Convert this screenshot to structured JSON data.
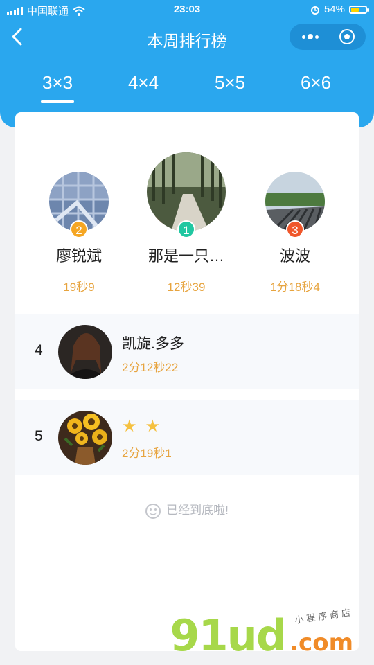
{
  "status_bar": {
    "carrier": "中国联通",
    "time": "23:03",
    "battery_percent": "54%",
    "battery_level": 0.54
  },
  "nav": {
    "title": "本周排行榜"
  },
  "tabs": [
    {
      "label": "3×3",
      "active": true
    },
    {
      "label": "4×4",
      "active": false
    },
    {
      "label": "5×5",
      "active": false
    },
    {
      "label": "6×6",
      "active": false
    }
  ],
  "podium": [
    {
      "rank": "2",
      "name": "廖锐斌",
      "time": "19秒9",
      "badge_color": "#f5a623"
    },
    {
      "rank": "1",
      "name": "那是一只…",
      "time": "12秒39",
      "badge_color": "#20c7a1"
    },
    {
      "rank": "3",
      "name": "波波",
      "time": "1分18秒4",
      "badge_color": "#f0572b"
    }
  ],
  "list": [
    {
      "rank": "4",
      "name": "凯旋.多多",
      "time": "2分12秒22"
    },
    {
      "rank": "5",
      "name_icons": [
        "star-icon",
        "star-icon"
      ],
      "time": "2分19秒1"
    }
  ],
  "footer_note": "已经到底啦!",
  "watermark": {
    "main": "91ud",
    "suffix": ".com",
    "subtitle": "小程序商店"
  },
  "colors": {
    "header": "#2aa7ee",
    "time_text": "#e7a43f"
  }
}
